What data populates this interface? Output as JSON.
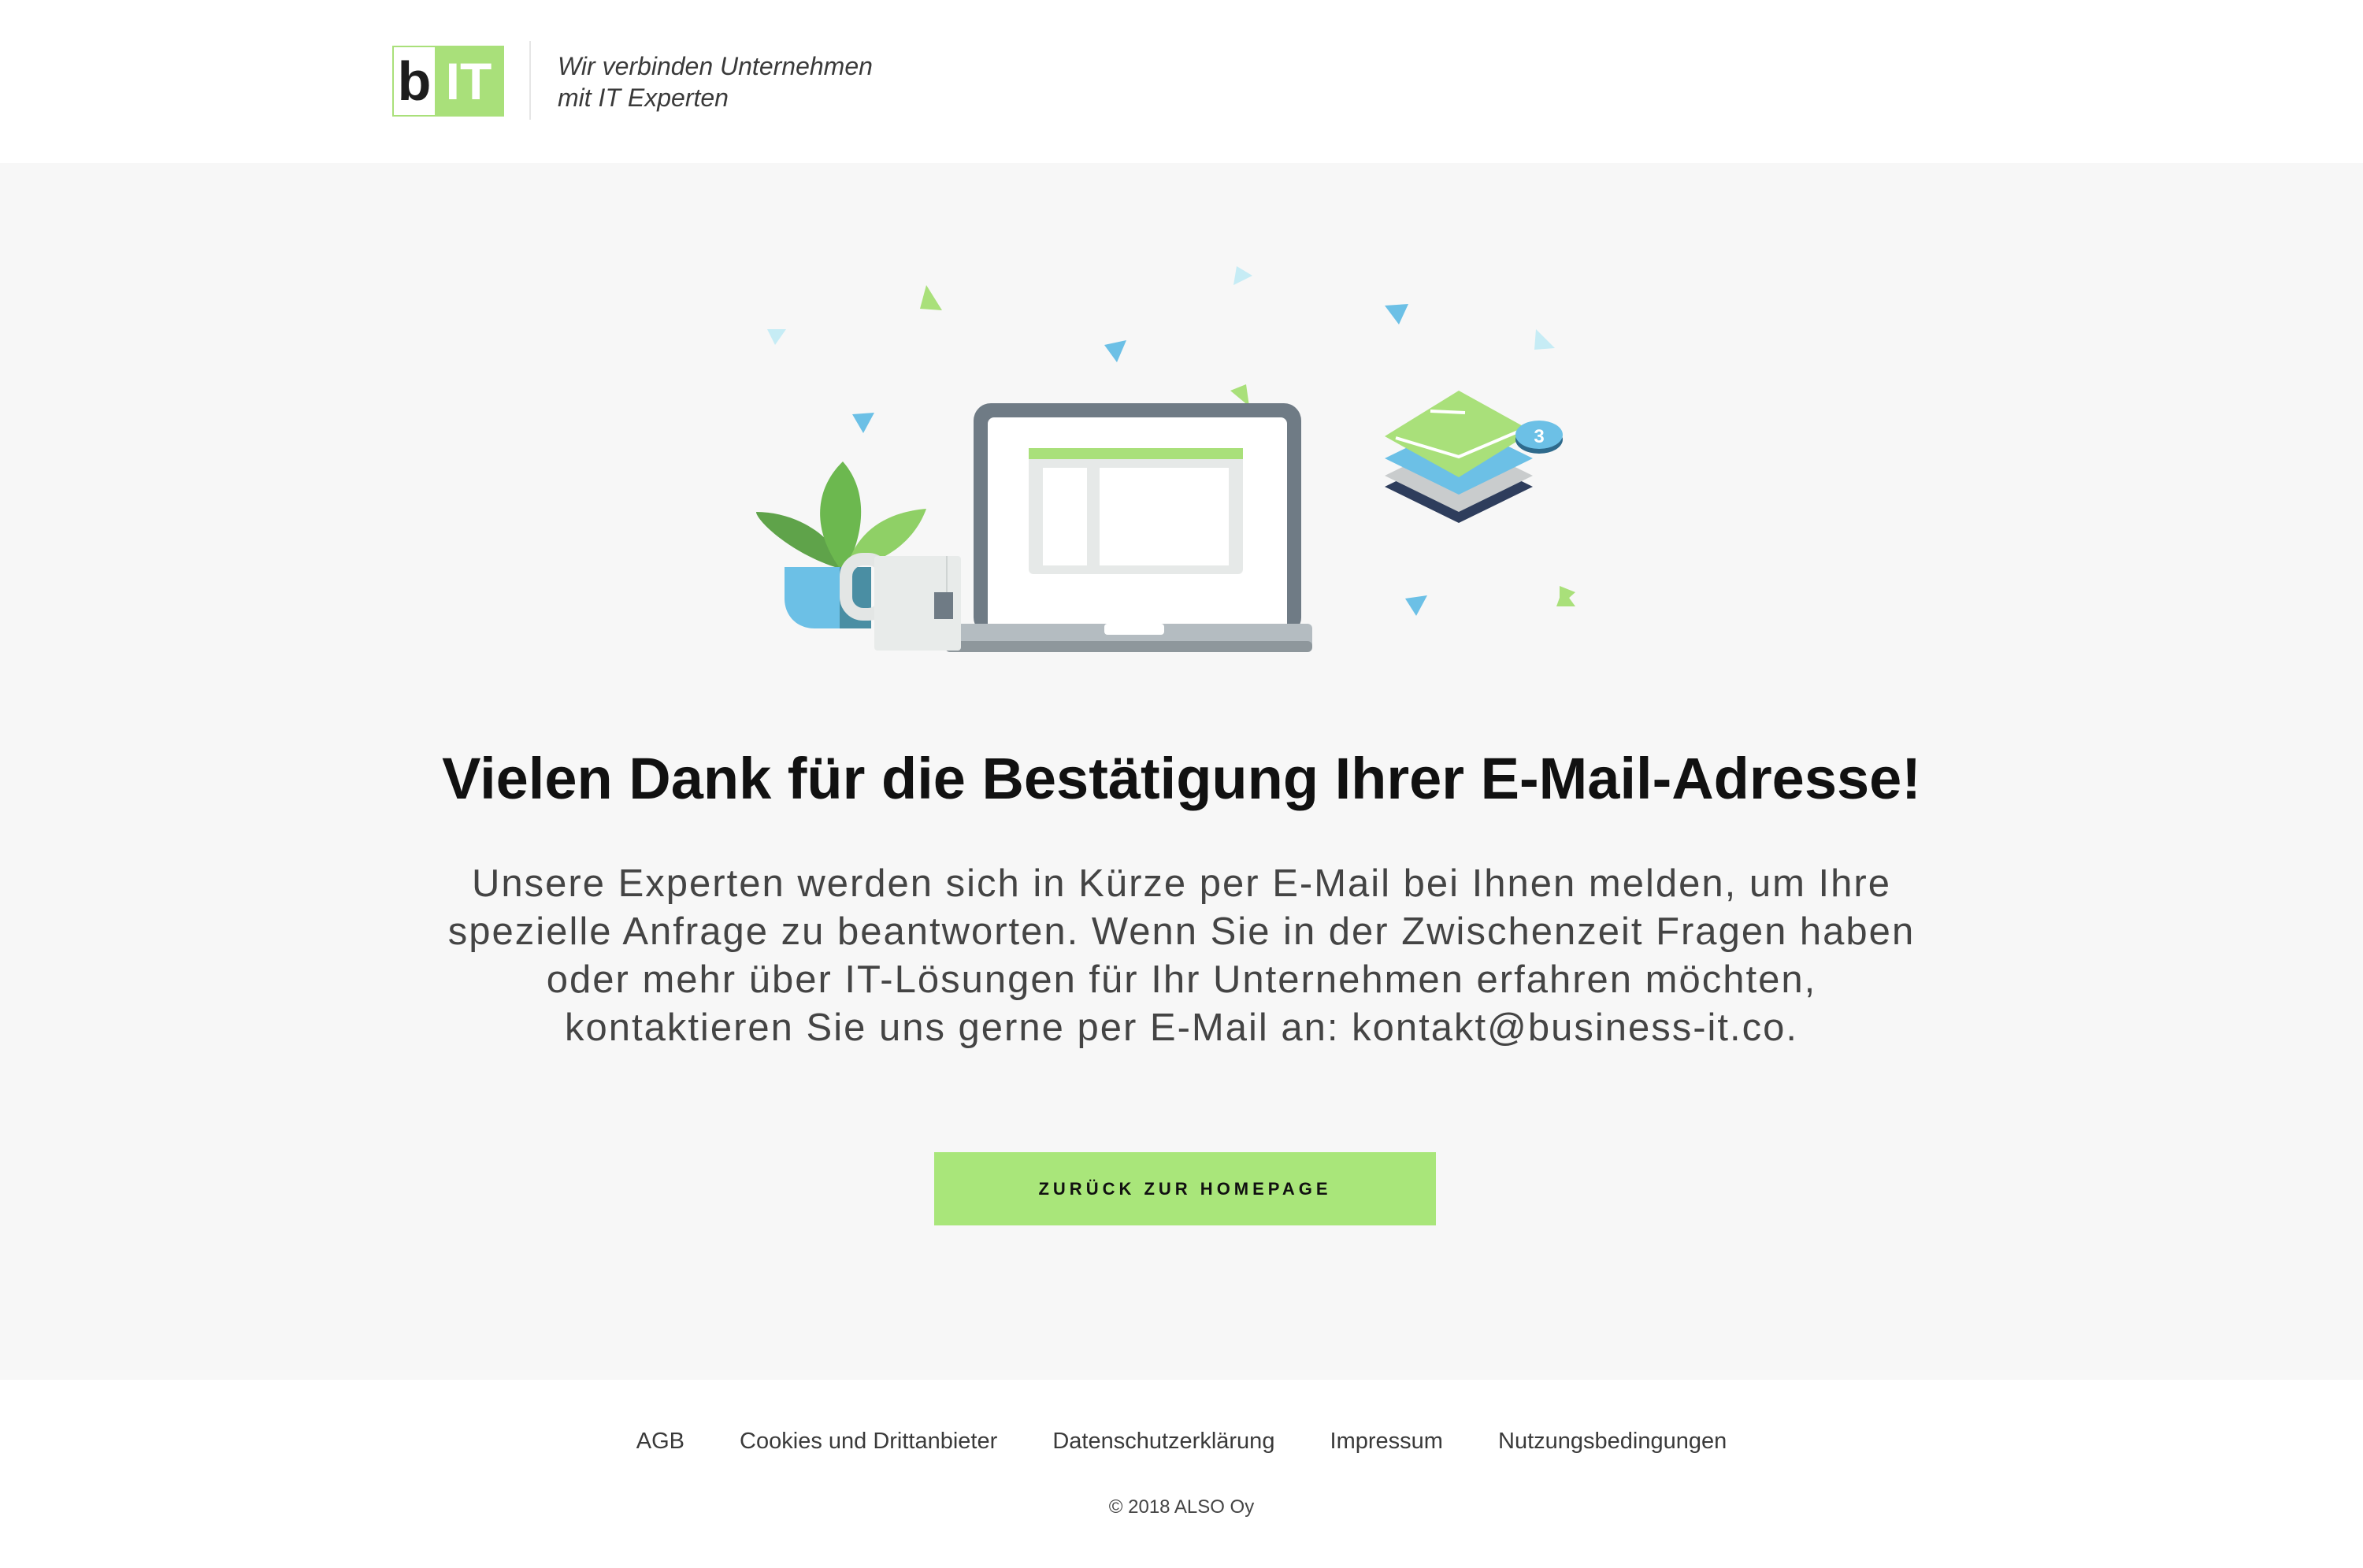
{
  "header": {
    "logo_b": "b",
    "logo_it": "IT",
    "tagline_line1": "Wir verbinden Unternehmen",
    "tagline_line2": "mit IT Experten"
  },
  "main": {
    "illustration": {
      "icons": [
        "plant-icon",
        "mug-icon",
        "laptop-icon",
        "mail-stack-icon",
        "confetti-icon"
      ],
      "mail_badge_count": "3"
    },
    "headline": "Vielen Dank für die Bestätigung Ihrer E-Mail-Adresse!",
    "body_line1": "Unsere Experten werden sich in Kürze per E-Mail bei Ihnen melden, um Ihre",
    "body_line2": "spezielle Anfrage zu beantworten. Wenn Sie in der Zwischenzeit Fragen haben",
    "body_line3": "oder mehr über IT-Lösungen für Ihr Unternehmen erfahren möchten,",
    "body_line4": "kontaktieren Sie uns gerne per E-Mail an:  kontakt@business-it.co.",
    "cta_label": "ZURÜCK ZUR HOMEPAGE"
  },
  "footer": {
    "links": [
      "AGB",
      "Cookies und Drittanbieter",
      "Datenschutzerklärung",
      "Impressum",
      "Nutzungsbedingungen"
    ],
    "copyright": "© 2018 ALSO Oy"
  },
  "colors": {
    "accent_green": "#a9e67a",
    "background_main": "#f7f7f7",
    "laptop_frame": "#6f7b85",
    "sky_blue": "#6cc0e6",
    "dark_navy": "#2e3d5c"
  }
}
